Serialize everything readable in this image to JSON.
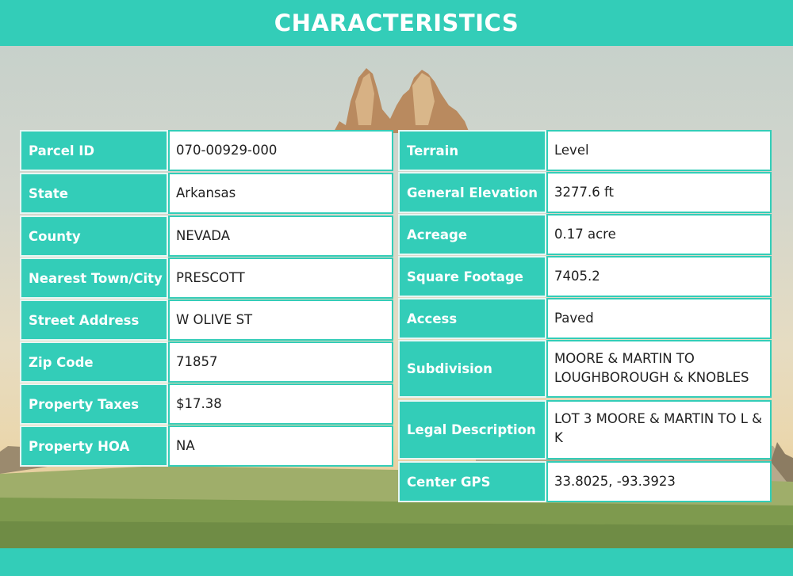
{
  "title": "CHARACTERISTICS",
  "left_rows": [
    {
      "label": "Parcel ID",
      "value": "070-00929-000"
    },
    {
      "label": "State",
      "value": "Arkansas"
    },
    {
      "label": "County",
      "value": "NEVADA"
    },
    {
      "label": "Nearest Town/City",
      "value": "PRESCOTT"
    },
    {
      "label": "Street Address",
      "value": "W OLIVE ST"
    },
    {
      "label": "Zip Code",
      "value": "71857"
    },
    {
      "label": "Property Taxes",
      "value": "$17.38"
    },
    {
      "label": "Property HOA",
      "value": "NA"
    }
  ],
  "right_rows": [
    {
      "label": "Terrain",
      "value": "Level"
    },
    {
      "label": "General Elevation",
      "value": "3277.6 ft"
    },
    {
      "label": "Acreage",
      "value": "0.17 acre"
    },
    {
      "label": "Square Footage",
      "value": "7405.2"
    },
    {
      "label": "Access",
      "value": "Paved"
    },
    {
      "label": "Subdivision",
      "value": "MOORE & MARTIN TO LOUGHBOROUGH & KNOBLES"
    },
    {
      "label": "Legal Description",
      "value": "LOT 3 MOORE & MARTIN TO L & K"
    },
    {
      "label": "Center GPS",
      "value": "33.8025, -93.3923"
    }
  ],
  "colors": {
    "accent": "#33cdb8",
    "text": "#1f1f1f",
    "white": "#ffffff"
  }
}
